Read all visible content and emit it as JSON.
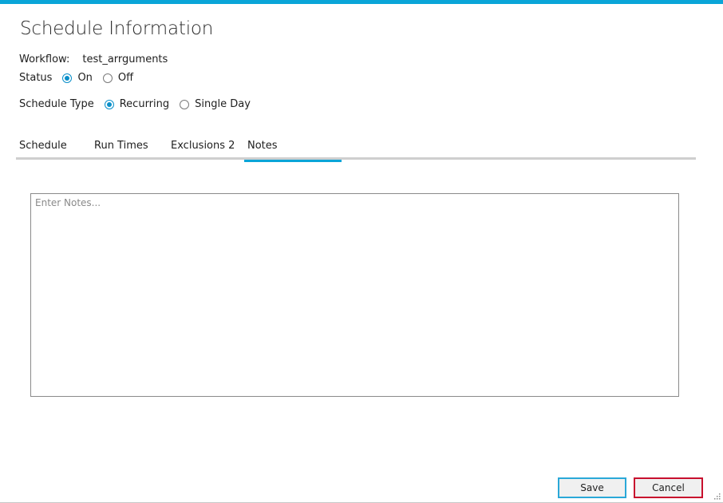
{
  "dialog": {
    "title": "Schedule Information"
  },
  "workflow": {
    "label": "Workflow:",
    "value": "test_arrguments"
  },
  "status": {
    "label": "Status",
    "options": [
      {
        "label": "On",
        "checked": true
      },
      {
        "label": "Off",
        "checked": false
      }
    ]
  },
  "schedule_type": {
    "label": "Schedule Type",
    "options": [
      {
        "label": "Recurring",
        "checked": true
      },
      {
        "label": "Single Day",
        "checked": false
      }
    ]
  },
  "tabs": [
    {
      "label": "Schedule",
      "active": false
    },
    {
      "label": "Run Times",
      "active": false
    },
    {
      "label": "Exclusions 2",
      "active": false
    },
    {
      "label": "Notes",
      "active": true
    }
  ],
  "notes": {
    "value": "",
    "placeholder": "Enter Notes..."
  },
  "buttons": {
    "save_label": "Save",
    "cancel_label": "Cancel"
  },
  "colors": {
    "accent": "#0aa5d8",
    "save_border": "#2aa8d8",
    "cancel_border": "#c8102e",
    "tab_underline": "#cfcfcf"
  },
  "icons": {
    "resize_grip": "resize-grip-icon"
  }
}
